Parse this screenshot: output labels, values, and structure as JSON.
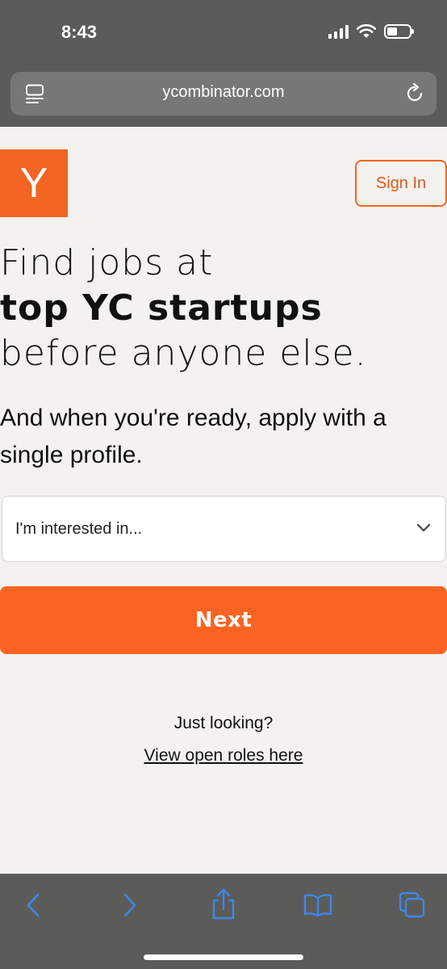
{
  "status_bar": {
    "time": "8:43"
  },
  "browser": {
    "url": "ycombinator.com"
  },
  "header": {
    "logo_letter": "Y",
    "sign_in_label": "Sign In"
  },
  "hero": {
    "line1": "Find jobs at",
    "line2": "top YC startups",
    "line3": "before anyone else.",
    "subtext": "And when you're ready, apply with a single profile."
  },
  "form": {
    "interest_select_value": "I'm interested in...",
    "next_label": "Next"
  },
  "footer_links": {
    "just_looking": "Just looking?",
    "view_roles": "View open roles here"
  },
  "colors": {
    "accent": "#fa6321",
    "chrome": "#5b5c58",
    "background": "#f4f2ee",
    "toolbar_icons": "#3f86e8"
  },
  "icons": [
    "reader-mode-icon",
    "reload-icon",
    "chevron-down-icon",
    "back-icon",
    "forward-icon",
    "share-icon",
    "bookmarks-icon",
    "tabs-icon"
  ]
}
